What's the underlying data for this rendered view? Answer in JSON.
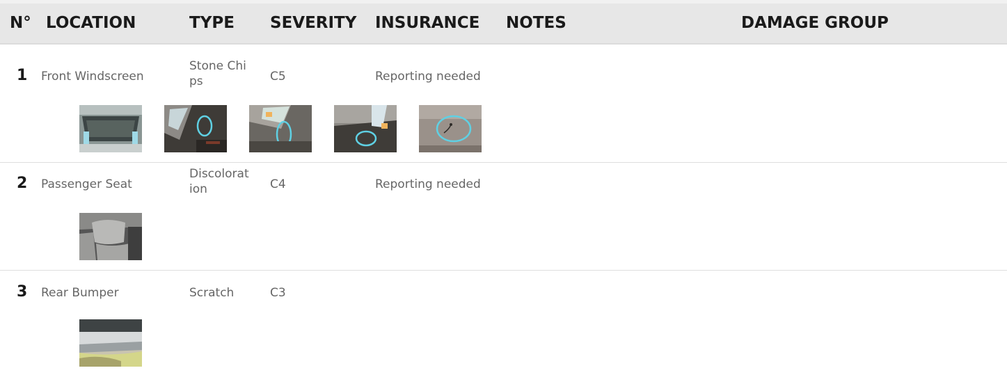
{
  "header": {
    "num": "N°",
    "location": "LOCATION",
    "type": "TYPE",
    "severity": "SEVERITY",
    "insurance": "INSURANCE",
    "notes": "NOTES",
    "damage_group": "DAMAGE GROUP"
  },
  "rows": [
    {
      "num": "1",
      "location": "Front Windscreen",
      "type": "Stone Chips",
      "severity": "C5",
      "insurance": "Reporting needed",
      "notes": "",
      "damage_group": "",
      "photos": [
        "windscreen-photo",
        "chip-photo",
        "chip-photo",
        "chip-photo",
        "chip-photo"
      ]
    },
    {
      "num": "2",
      "location": "Passenger Seat",
      "type": "Discoloration",
      "severity": "C4",
      "insurance": "Reporting needed",
      "notes": "",
      "damage_group": "",
      "photos": [
        "seat-photo"
      ]
    },
    {
      "num": "3",
      "location": "Rear Bumper",
      "type": "Scratch",
      "severity": "C3",
      "insurance": "",
      "notes": "",
      "damage_group": "",
      "photos": [
        "bumper-photo"
      ]
    }
  ]
}
